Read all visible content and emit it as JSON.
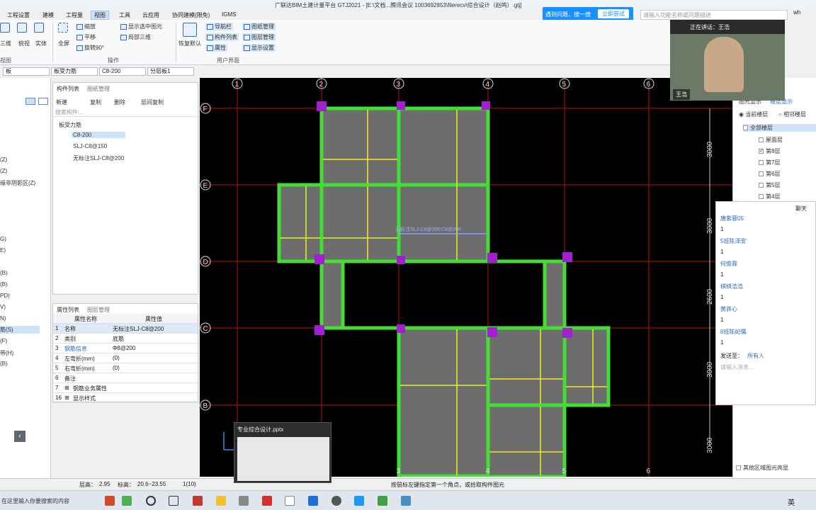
{
  "window": {
    "title": "广联达BIM土建计量平台 GTJ2021 - [E:\\文档...腾讯会议 1003692853\\filerecv\\综合设计（赵鸣）.gtj]",
    "user": "wh"
  },
  "ad": {
    "text": "遇到问题，搜一搜",
    "button": "立即尝试"
  },
  "search": {
    "placeholder": "请输入功能名称或问题描述"
  },
  "menu": [
    "工程设置",
    "建模",
    "工程量",
    "视图",
    "工具",
    "云应用",
    "协同建模(限免)",
    "IGMS"
  ],
  "ribbon": {
    "view3d": [
      "三维",
      "俯视",
      "实体"
    ],
    "fullscreen": "全屏",
    "zoom": "缩放",
    "pan": "平移",
    "rotate": "旋转90°",
    "show_selected": "显示选中图元",
    "local3d": "局部三维",
    "restore": "恢复默认",
    "ui_buttons": [
      "导航栏",
      "构件列表",
      "属性",
      "图纸管理",
      "图层管理",
      "显示设置"
    ],
    "groups": [
      "视图",
      "操作",
      "用户界面"
    ]
  },
  "selectors": [
    "板",
    "板受力筋",
    "C8-200",
    "分层板1"
  ],
  "left_items": [
    "(Z)",
    "(Z)",
    "缘非阴影区(Z)",
    "G)",
    "E)",
    "(B)",
    "(B)",
    "PD)",
    "V)",
    "N)",
    "筋(S)",
    "(F)",
    "带(H)",
    "(B)"
  ],
  "components": {
    "tabs": [
      "构件列表",
      "图纸管理"
    ],
    "tools": [
      "新建",
      "复制",
      "删除",
      "层间复制"
    ],
    "search_placeholder": "搜索构件...",
    "tree_root": "板受力筋",
    "items": [
      "C8-200",
      "SLJ-C8@150",
      "无标注SLJ-C8@200"
    ]
  },
  "properties": {
    "tabs": [
      "属性列表",
      "图层管理"
    ],
    "headers": [
      "属性名称",
      "属性值"
    ],
    "rows": [
      {
        "n": "1",
        "name": "名称",
        "value": "无标注SLJ-C8@200"
      },
      {
        "n": "2",
        "name": "类别",
        "value": "底筋"
      },
      {
        "n": "3",
        "name": "钢筋信息",
        "value": "Φ8@200"
      },
      {
        "n": "4",
        "name": "左弯折(mm)",
        "value": "(0)"
      },
      {
        "n": "5",
        "name": "右弯折(mm)",
        "value": "(0)"
      },
      {
        "n": "6",
        "name": "备注",
        "value": ""
      },
      {
        "n": "7",
        "name": "钢筋业务属性",
        "value": ""
      },
      {
        "n": "16",
        "name": "显示样式",
        "value": ""
      }
    ]
  },
  "canvas": {
    "col_axes": [
      "1",
      "2",
      "3",
      "4",
      "5",
      "6"
    ],
    "row_axes": [
      "F",
      "E",
      "D",
      "C",
      "B"
    ],
    "dims": [
      "3000",
      "3000",
      "2600",
      "3000",
      "3000"
    ],
    "bar_label": "无标注SLJ-C8@200:C8@200"
  },
  "floors": {
    "tabs": [
      "图元显示",
      "楼层显示"
    ],
    "radio": [
      "当前楼层",
      "相邻楼层"
    ],
    "all": "全部楼层",
    "items": [
      "屋面层",
      "第8层",
      "第7层",
      "第6层",
      "第5层",
      "第4层"
    ],
    "bottom": "其他区域图元亮显"
  },
  "chat": {
    "title": "聊天",
    "messages": [
      {
        "name": "唐紫蓉05",
        "text": "1"
      },
      {
        "name": "5班陈泽安",
        "text": "1"
      },
      {
        "name": "何俊霖",
        "text": "1"
      },
      {
        "name": "棋棋浩浩",
        "text": "1"
      },
      {
        "name": "黄骅心",
        "text": "1"
      },
      {
        "name": "6班陈妃儒",
        "text": "1"
      }
    ],
    "send_to_label": "发送至：",
    "send_to": "所有人",
    "input_placeholder": "请输入消息..."
  },
  "video": {
    "speaking": "正在讲话：王浩",
    "name": "王浩"
  },
  "status": {
    "floor_height": "层高：",
    "floor_height_val": "2.95",
    "elevation": "标高：",
    "elevation_val": "20.6~23.55",
    "count": "1(10)",
    "hint": "按鼠标左键指定第一个角点，或拾取构件图元"
  },
  "ppt": {
    "title": "专业综合设计.pptx"
  },
  "taskbar": {
    "search": "在这里输入你要搜索的内容",
    "ime": "英"
  }
}
